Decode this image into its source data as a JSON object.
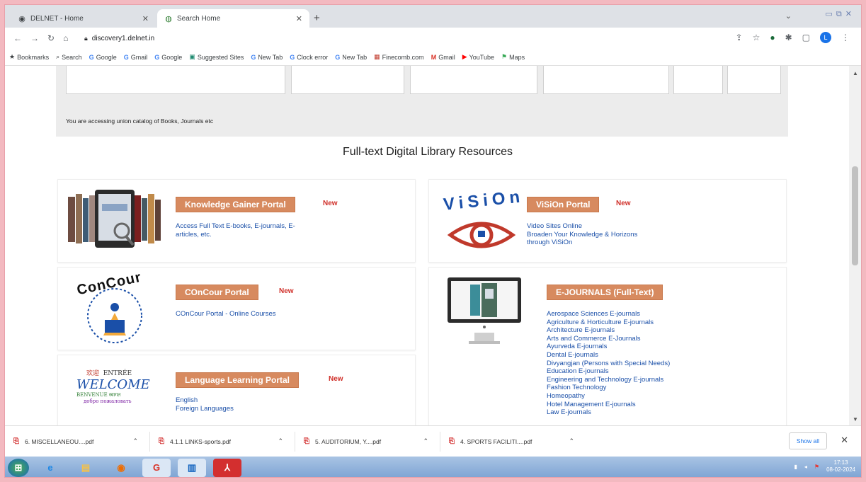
{
  "browser": {
    "tabs": [
      {
        "title": "DELNET - Home",
        "icon": "delnet-favicon"
      },
      {
        "title": "Search Home",
        "icon": "search-favicon"
      }
    ],
    "new_tab": "+",
    "window_controls": "⌄ ▭ ⧉ ✕",
    "url": "discovery1.delnet.in",
    "bookmarks": [
      {
        "label": "Bookmarks",
        "icon": "star-icon"
      },
      {
        "label": "Search",
        "icon": "search-icon"
      },
      {
        "label": "Google",
        "icon": "google-icon"
      },
      {
        "label": "Gmail",
        "icon": "google-icon"
      },
      {
        "label": "Google",
        "icon": "google-icon"
      },
      {
        "label": "Suggested Sites",
        "icon": "site-icon"
      },
      {
        "label": "New Tab",
        "icon": "google-icon"
      },
      {
        "label": "Clock error",
        "icon": "google-icon"
      },
      {
        "label": "New Tab",
        "icon": "google-icon"
      },
      {
        "label": "Finecomb.com",
        "icon": "site-icon"
      },
      {
        "label": "Gmail",
        "icon": "gmail-icon"
      },
      {
        "label": "YouTube",
        "icon": "youtube-icon"
      },
      {
        "label": "Maps",
        "icon": "maps-icon"
      }
    ]
  },
  "page": {
    "union_note": "You are accessing union catalog of Books, Journals etc",
    "section_title": "Full-text Digital Library Resources",
    "new_label": "New",
    "cards": {
      "knowledge": {
        "button": "Knowledge Gainer Portal",
        "lines": [
          "Access Full Text E-books, E-journals, E-",
          "articles, etc."
        ]
      },
      "vision": {
        "button": "ViSiOn Portal",
        "lines": [
          "Video Sites Online",
          "Broaden Your Knowledge & Horizons",
          "through ViSiOn"
        ],
        "logo_text": "ViSiOn"
      },
      "concour": {
        "button": "COnCour Portal",
        "lines": [
          "COnCour Portal - Online Courses"
        ],
        "logo_text": "ConCour"
      },
      "ejournals": {
        "button": "E-JOURNALS (Full-Text)",
        "lines": [
          "Aerospace Sciences E-journals",
          "Agriculture & Horticulture E-journals",
          "Architecture E-journals",
          "Arts and Commerce E-Journals",
          "Ayurveda E-journals",
          "Dental E-journals",
          "Divyangjan (Persons with Special Needs)",
          "Education E-journals",
          "Engineering and Technology E-journals",
          "Fashion Technology",
          "Homeopathy",
          "Hotel Management E-journals",
          "Law E-journals"
        ]
      },
      "language": {
        "button": "Language Learning Portal",
        "lines": [
          "English",
          "Foreign Languages"
        ],
        "logo_text": "WELCOME"
      }
    }
  },
  "downloads": {
    "items": [
      "6. MISCELLANEOU....pdf",
      "4.1.1 LINKS-sports.pdf",
      "5. AUDITORIUM, Y....pdf",
      "4. SPORTS FACILITI....pdf"
    ],
    "show_all": "Show all"
  },
  "taskbar": {
    "time": "17:13",
    "date": "08-02-2024"
  },
  "colors": {
    "portal_button": "#d78a5f",
    "new_badge": "#d0302a",
    "link": "#1a4fa8"
  }
}
